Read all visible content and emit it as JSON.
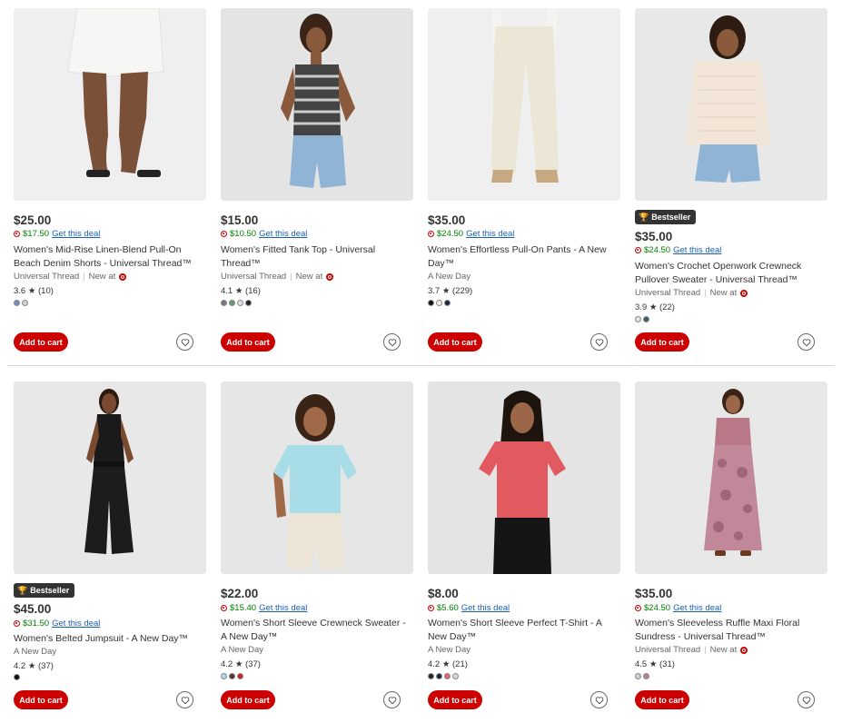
{
  "products": [
    {
      "price": "$25.00",
      "deal_price": "$17.50",
      "deal_link": "Get this deal",
      "title": "Women's Mid-Rise Linen-Blend Pull-On Beach Denim Shorts - Universal Thread™",
      "brand": "Universal Thread",
      "new_at": "New at",
      "rating": "3.6 ★ (10)",
      "swatches": [
        "#6e8fc0",
        "#d0d0d0"
      ],
      "cart_label": "Add to cart"
    },
    {
      "price": "$15.00",
      "deal_price": "$10.50",
      "deal_link": "Get this deal",
      "title": "Women's Fitted Tank Top - Universal Thread™",
      "brand": "Universal Thread",
      "new_at": "New at",
      "rating": "4.1 ★ (16)",
      "swatches": [
        "#777777",
        "#5aa070",
        "#e0e0e0",
        "#222222"
      ],
      "cart_label": "Add to cart"
    },
    {
      "price": "$35.00",
      "deal_price": "$24.50",
      "deal_link": "Get this deal",
      "title": "Women's Effortless Pull-On Pants - A New Day™",
      "brand": "A New Day",
      "rating": "3.7 ★ (229)",
      "swatches": [
        "#111111",
        "#f2efe6",
        "#1c2240"
      ],
      "cart_label": "Add to cart"
    },
    {
      "badge": "Bestseller",
      "price": "$35.00",
      "deal_price": "$24.50",
      "deal_link": "Get this deal",
      "title": "Women's Crochet Openwork Crewneck Pullover Sweater - Universal Thread™",
      "brand": "Universal Thread",
      "new_at": "New at",
      "rating": "3.9 ★ (22)",
      "swatches": [
        "#e6e2d8",
        "#3e5c66"
      ],
      "cart_label": "Add to cart"
    },
    {
      "badge": "Bestseller",
      "price": "$45.00",
      "deal_price": "$31.50",
      "deal_link": "Get this deal",
      "title": "Women's Belted Jumpsuit - A New Day™",
      "brand": "A New Day",
      "rating": "4.2 ★ (37)",
      "swatches": [
        "#111111"
      ],
      "cart_label": "Add to cart"
    },
    {
      "price": "$22.00",
      "deal_price": "$15.40",
      "deal_link": "Get this deal",
      "title": "Women's Short Sleeve Crewneck Sweater - A New Day™",
      "brand": "A New Day",
      "rating": "4.2 ★ (37)",
      "swatches": [
        "#a8dde8",
        "#5a3030",
        "#d02030"
      ],
      "cart_label": "Add to cart"
    },
    {
      "price": "$8.00",
      "deal_price": "$5.60",
      "deal_link": "Get this deal",
      "title": "Women's Short Sleeve Perfect T-Shirt - A New Day™",
      "brand": "A New Day",
      "rating": "4.2 ★ (21)",
      "swatches": [
        "#222222",
        "#1c2240",
        "#e06870",
        "#d8d8d8"
      ],
      "cart_label": "Add to cart"
    },
    {
      "price": "$35.00",
      "deal_price": "$24.50",
      "deal_link": "Get this deal",
      "title": "Women's Sleeveless Ruffle Maxi Floral Sundress - Universal Thread™",
      "brand": "Universal Thread",
      "new_at": "New at",
      "rating": "4.5 ★ (31)",
      "swatches": [
        "#d0d0d0",
        "#c08090"
      ],
      "cart_label": "Add to cart"
    }
  ],
  "colors": {
    "accent": "#cc0000",
    "deal": "#008300",
    "link": "#1a5fb4"
  },
  "icons": {
    "favorite": "heart-icon",
    "badge": "trophy-icon",
    "store": "target-logo-icon"
  }
}
